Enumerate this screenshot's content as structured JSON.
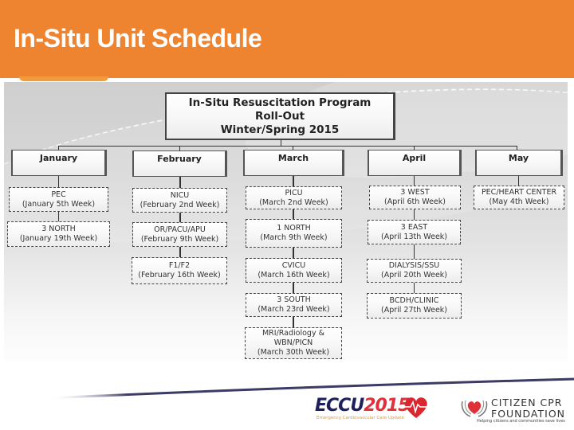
{
  "slide": {
    "title": "In-Situ Unit Schedule",
    "header_color": "#ee8330"
  },
  "org_chart": {
    "root": {
      "line1": "In-Situ Resuscitation Program",
      "line2": "Roll-Out",
      "line3": "Winter/Spring 2015"
    },
    "months": [
      {
        "label": "January",
        "units": [
          {
            "name": "PEC",
            "week": "(January 5th Week)"
          },
          {
            "name": "3 NORTH",
            "week": "(January 19th Week)"
          }
        ]
      },
      {
        "label": "February",
        "units": [
          {
            "name": "NICU",
            "week": "(February 2nd Week)"
          },
          {
            "name": "OR/PACU/APU",
            "week": "(February 9th Week)"
          },
          {
            "name": "F1/F2",
            "week": "(February 16th Week)"
          }
        ]
      },
      {
        "label": "March",
        "units": [
          {
            "name": "PICU",
            "week": "(March 2nd Week)"
          },
          {
            "name": "1 NORTH",
            "week": "(March 9th Week)"
          },
          {
            "name": "CVICU",
            "week": "(March 16th Week)"
          },
          {
            "name": "3 SOUTH",
            "week": "(March 23rd Week)"
          },
          {
            "name": "MRI/Radiology & WBN/PICN",
            "week": "(March 30th Week)"
          }
        ]
      },
      {
        "label": "April",
        "units": [
          {
            "name": "3 WEST",
            "week": "(April 6th Week)"
          },
          {
            "name": "3 EAST",
            "week": "(April 13th Week)"
          },
          {
            "name": "DIALYSIS/SSU",
            "week": "(April 20th Week)"
          },
          {
            "name": "BCDH/CLINIC",
            "week": "(April 27th Week)"
          }
        ]
      },
      {
        "label": "May",
        "units": [
          {
            "name": "PEC/HEART CENTER",
            "week": "(May 4th Week)"
          }
        ]
      }
    ]
  },
  "footer": {
    "eccu_logo": {
      "part1": "ECCU",
      "part2": "2015",
      "tagline": "Emergency Cardiovascular Care Update",
      "icon": "heart-ecg-icon"
    },
    "cpr_logo": {
      "line1": "CITIZEN CPR",
      "line2": "FOUNDATION",
      "tagline": "Helping citizens and communities save lives",
      "icon": "hands-heart-icon"
    }
  }
}
